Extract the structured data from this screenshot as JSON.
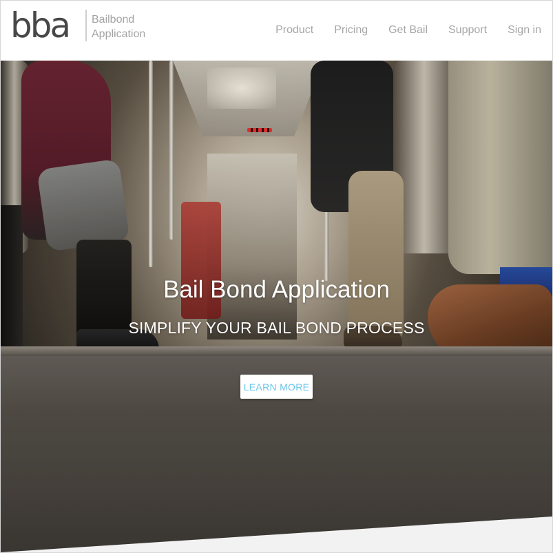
{
  "brand": {
    "logo_text": "bba",
    "sub_line1": "Bailbond",
    "sub_line2": "Application"
  },
  "nav": {
    "items": [
      {
        "label": "Product"
      },
      {
        "label": "Pricing"
      },
      {
        "label": "Get Bail"
      },
      {
        "label": "Support"
      },
      {
        "label": "Sign in"
      }
    ]
  },
  "hero": {
    "title": "Bail Bond Application",
    "subtitle": "SIMPLIFY YOUR BAIL BOND PROCESS",
    "cta_label": "LEARN MORE",
    "cta_color": "#6cc6e8"
  },
  "colors": {
    "logo": "#474747",
    "nav_text": "#a6a6a6",
    "logo_sub_text": "#a3a3a3"
  }
}
